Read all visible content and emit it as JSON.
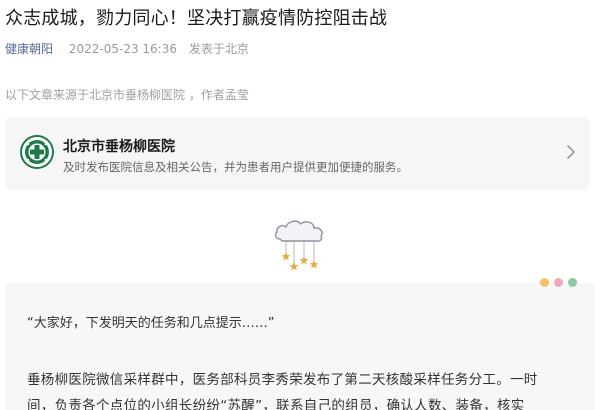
{
  "article": {
    "title": "众志成城，勠力同心！坚决打赢疫情防控阻击战",
    "account": "健康朝阳",
    "date": "2022-05-23 16:36",
    "location": "发表于北京",
    "source_note": "以下文章来源于北京市垂杨柳医院 ，作者孟莹"
  },
  "source_card": {
    "name": "北京市垂杨柳医院",
    "description": "及时发布医院信息及相关公告，并为患者用户提供更加便捷的服务。",
    "icon": "hospital-logo-icon",
    "chevron_icon": "chevron-right-icon"
  },
  "decoration": {
    "cloud_icon": "cloud-stars-icon",
    "dot_colors": [
      "#f5c16c",
      "#f2a9b8",
      "#8cc9a0"
    ]
  },
  "content": {
    "quote": "“大家好，下发明天的任务和几点提示……”",
    "paragraph_line1": "垂杨柳医院微信采样群中，医务部科员李秀荣发布了第二天核酸采样任务分工。一时",
    "paragraph_line2": "间，负责各个点位的小组长纷纷“苏醒”，联系自己的组员，确认人数、装备，核实"
  },
  "colors": {
    "link": "#576b95",
    "logo_green": "#1f7a4a",
    "card_bg": "#f6f6f6"
  }
}
